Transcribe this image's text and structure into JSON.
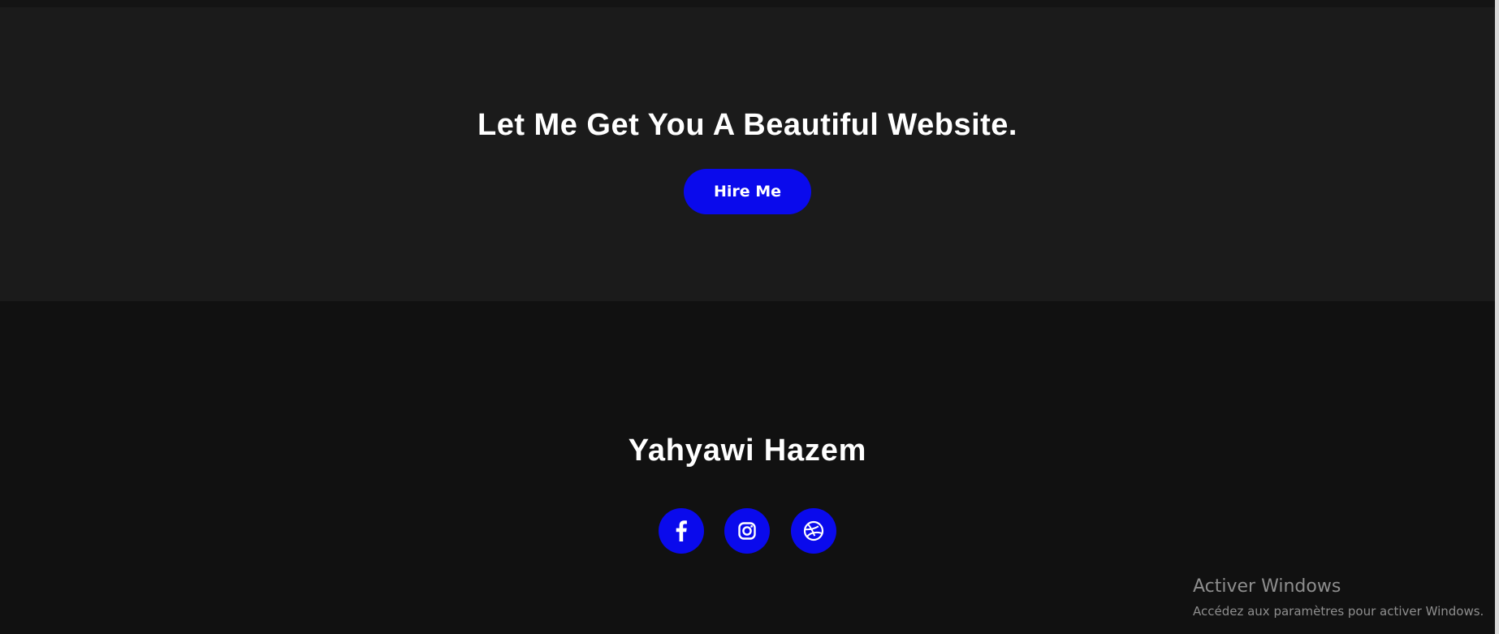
{
  "cta": {
    "title": "Let Me Get You A Beautiful Website.",
    "button_label": "Hire Me"
  },
  "footer": {
    "name": "Yahyawi Hazem",
    "social_links": [
      {
        "icon": "facebook-icon"
      },
      {
        "icon": "instagram-icon"
      },
      {
        "icon": "dribbble-icon"
      }
    ]
  },
  "windows_activation": {
    "title": "Activer Windows",
    "subtitle": "Accédez aux paramètres pour activer Windows."
  },
  "colors": {
    "accent": "#0a0aec",
    "cta_background": "#1b1b1b",
    "footer_background": "#111111",
    "text": "#ffffff",
    "watermark_text": "#8e8e8e"
  }
}
